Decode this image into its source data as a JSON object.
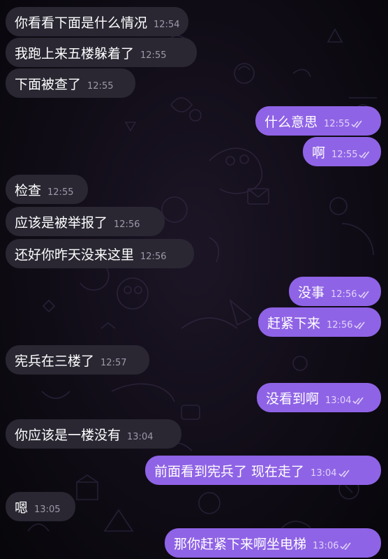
{
  "messages": [
    {
      "side": "in",
      "text": "你看看下面是什么情况",
      "time": "12:54"
    },
    {
      "side": "in",
      "text": "我跑上来五楼躲着了",
      "time": "12:55"
    },
    {
      "side": "in",
      "text": "下面被查了",
      "time": "12:55"
    },
    {
      "side": "out",
      "text": "什么意思",
      "time": "12:55",
      "read": true
    },
    {
      "side": "out",
      "text": "啊",
      "time": "12:55",
      "read": true
    },
    {
      "side": "in",
      "text": "检查",
      "time": "12:55"
    },
    {
      "side": "in",
      "text": "应该是被举报了",
      "time": "12:56"
    },
    {
      "side": "in",
      "text": "还好你昨天没来这里",
      "time": "12:56"
    },
    {
      "side": "out",
      "text": "没事",
      "time": "12:56",
      "read": true
    },
    {
      "side": "out",
      "text": "赶紧下来",
      "time": "12:56",
      "read": true
    },
    {
      "side": "in",
      "text": "宪兵在三楼了",
      "time": "12:57"
    },
    {
      "side": "out",
      "text": "没看到啊",
      "time": "13:04",
      "read": true
    },
    {
      "side": "in",
      "text": "你应该是一楼没有",
      "time": "13:04"
    },
    {
      "side": "out",
      "text": "前面看到宪兵了 现在走了",
      "time": "13:04",
      "read": true
    },
    {
      "side": "in",
      "text": "嗯",
      "time": "13:05"
    },
    {
      "side": "out",
      "text": "那你赶紧下来啊坐电梯",
      "time": "13:06",
      "read": true
    }
  ],
  "colors": {
    "incoming": "#2a2733",
    "outgoing": "#8f63e6",
    "background": "#0d0a12"
  }
}
